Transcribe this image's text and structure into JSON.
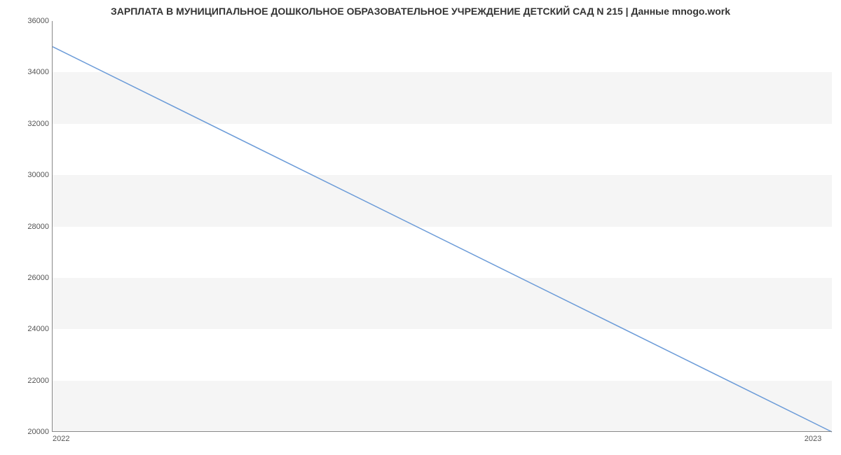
{
  "chart_data": {
    "type": "line",
    "title": "ЗАРПЛАТА В МУНИЦИПАЛЬНОЕ ДОШКОЛЬНОЕ ОБРАЗОВАТЕЛЬНОЕ УЧРЕЖДЕНИЕ ДЕТСКИЙ САД N 215 | Данные mnogo.work",
    "x": [
      2022,
      2023
    ],
    "values": [
      35000,
      20000
    ],
    "xlabel": "",
    "ylabel": "",
    "xlim": [
      2022,
      2023
    ],
    "ylim": [
      20000,
      36000
    ],
    "y_ticks": [
      20000,
      22000,
      24000,
      26000,
      28000,
      30000,
      32000,
      34000,
      36000
    ],
    "x_ticks": [
      2022,
      2023
    ],
    "line_color": "#6b9bd8",
    "grid": true
  }
}
